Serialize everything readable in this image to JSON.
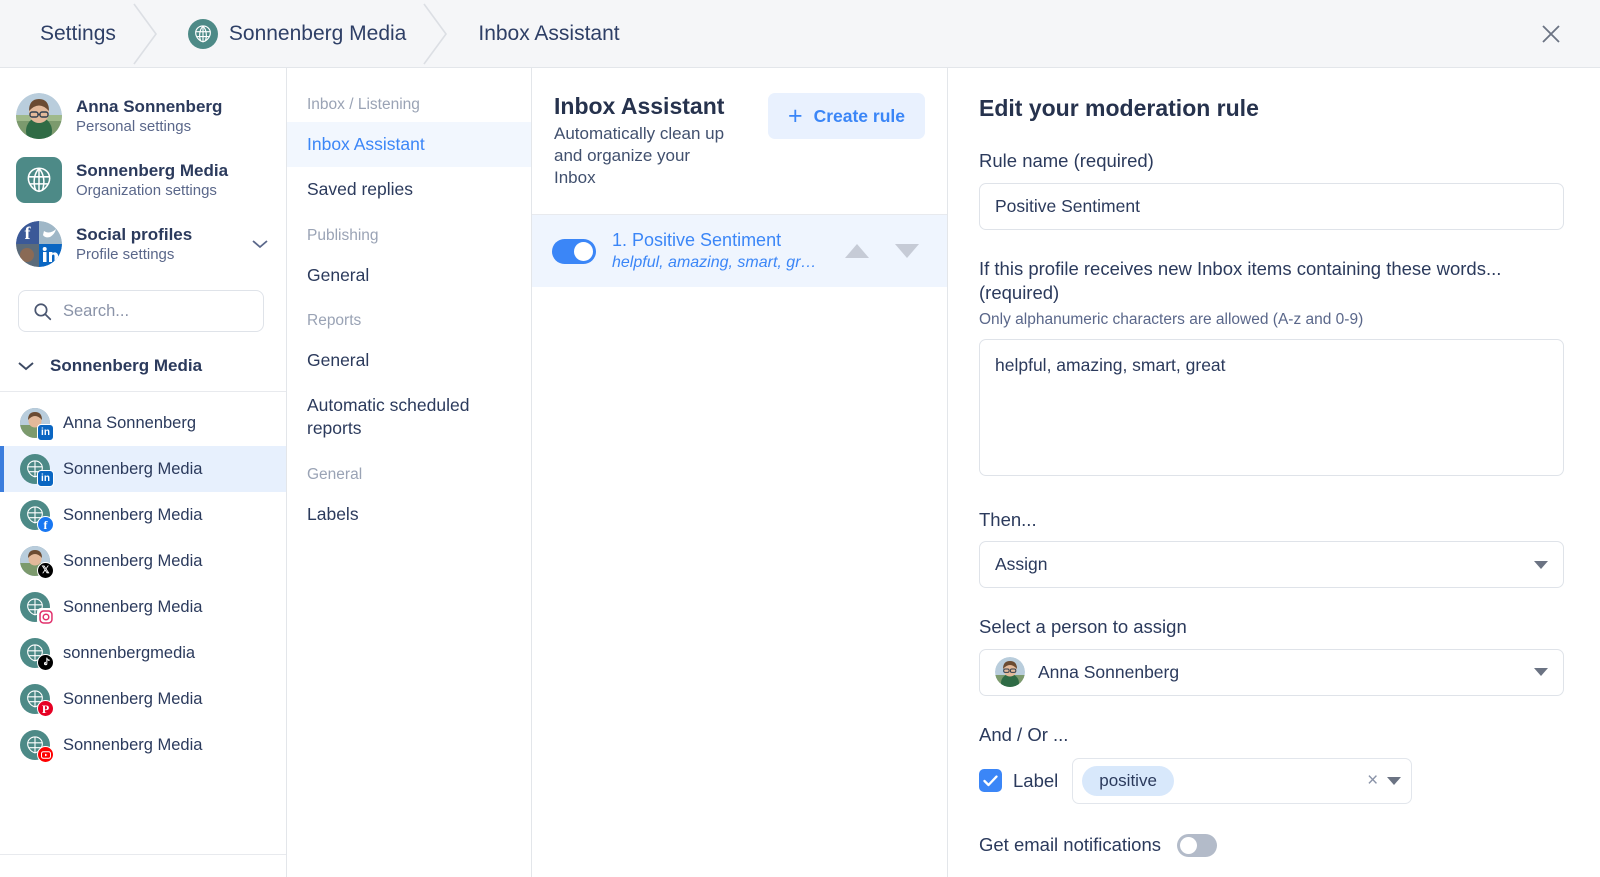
{
  "breadcrumb": {
    "items": [
      {
        "label": "Settings",
        "logo": false
      },
      {
        "label": "Sonnenberg Media",
        "logo": true
      },
      {
        "label": "Inbox Assistant",
        "logo": false
      }
    ],
    "close_icon": "close-icon"
  },
  "sidebar": {
    "accounts": [
      {
        "name": "Anna Sonnenberg",
        "sub": "Personal settings",
        "avatar": "photo-anna",
        "shape": "circle",
        "caret": false
      },
      {
        "name": "Sonnenberg Media",
        "sub": "Organization settings",
        "avatar": "logo-sonnenberg",
        "shape": "square",
        "caret": false
      },
      {
        "name": "Social profiles",
        "sub": "Profile settings",
        "avatar": "social-collage",
        "shape": "circle",
        "caret": true
      }
    ],
    "search": {
      "value": "",
      "placeholder": "Search...",
      "icon": "search-icon"
    },
    "group": {
      "label": "Sonnenberg Media",
      "icon": "chevron-down-icon",
      "expanded": true
    },
    "profiles": [
      {
        "name": "Anna Sonnenberg",
        "network": "linkedin",
        "avatar": "photo-anna",
        "selected": false
      },
      {
        "name": "Sonnenberg Media",
        "network": "linkedin",
        "avatar": "logo-sonnenberg",
        "selected": true
      },
      {
        "name": "Sonnenberg Media",
        "network": "facebook",
        "avatar": "logo-sonnenberg",
        "selected": false
      },
      {
        "name": "Sonnenberg Media",
        "network": "x",
        "avatar": "photo-anna",
        "selected": false
      },
      {
        "name": "Sonnenberg Media",
        "network": "instagram",
        "avatar": "logo-sonnenberg",
        "selected": false
      },
      {
        "name": "sonnenbergmedia",
        "network": "tiktok",
        "avatar": "logo-sonnenberg",
        "selected": false
      },
      {
        "name": "Sonnenberg Media",
        "network": "pinterest",
        "avatar": "logo-sonnenberg",
        "selected": false
      },
      {
        "name": "Sonnenberg Media",
        "network": "youtube",
        "avatar": "logo-sonnenberg",
        "selected": false
      }
    ]
  },
  "nav": {
    "groups": [
      {
        "section": "Inbox / Listening",
        "items": [
          {
            "label": "Inbox Assistant",
            "active": true
          },
          {
            "label": "Saved replies",
            "active": false
          }
        ]
      },
      {
        "section": "Publishing",
        "items": [
          {
            "label": "General",
            "active": false
          }
        ]
      },
      {
        "section": "Reports",
        "items": [
          {
            "label": "General",
            "active": false
          },
          {
            "label": "Automatic scheduled reports",
            "active": false
          }
        ]
      },
      {
        "section": "General",
        "items": [
          {
            "label": "Labels",
            "active": false
          }
        ]
      }
    ]
  },
  "rules_panel": {
    "title": "Inbox Assistant",
    "description": "Automatically clean up and organize your Inbox",
    "create_button": {
      "label": "Create rule",
      "icon": "plus-icon"
    },
    "rules": [
      {
        "enabled": true,
        "name": "1. Positive Sentiment",
        "words": "helpful, amazing, smart, gr…",
        "move_up_icon": "triangle-up-icon",
        "move_down_icon": "triangle-down-icon"
      }
    ]
  },
  "form": {
    "title": "Edit your moderation rule",
    "rule_name_label": "Rule name (required)",
    "rule_name_value": "Positive Sentiment",
    "words_label": "If this profile receives new Inbox items containing these words... (required)",
    "words_hint": "Only alphanumeric characters are allowed (A-z and 0-9)",
    "words_value": "helpful, amazing, smart, great",
    "then_label": "Then...",
    "then_value": "Assign",
    "assign_label": "Select a person to assign",
    "assign_value": "Anna Sonnenberg",
    "andor_label": "And / Or ...",
    "label_checkbox_label": "Label",
    "label_checkbox_checked": true,
    "label_chip": "positive",
    "chip_clear_icon": "close-small-icon",
    "chip_dropdown_icon": "chevron-down-icon",
    "notifications_label": "Get email notifications",
    "notifications_on": false
  },
  "colors": {
    "accent_blue": "#3b86f7",
    "accent_blue_soft": "#e9f1fe",
    "brand_teal": "#4d8a87",
    "text_dark": "#2b3a5c",
    "text_muted": "#9aa3b5",
    "header_bg": "#f5f6f8",
    "border": "#e3e6ea",
    "selected_row": "#e7f0fd",
    "chip_bg": "#d8e8fb"
  }
}
